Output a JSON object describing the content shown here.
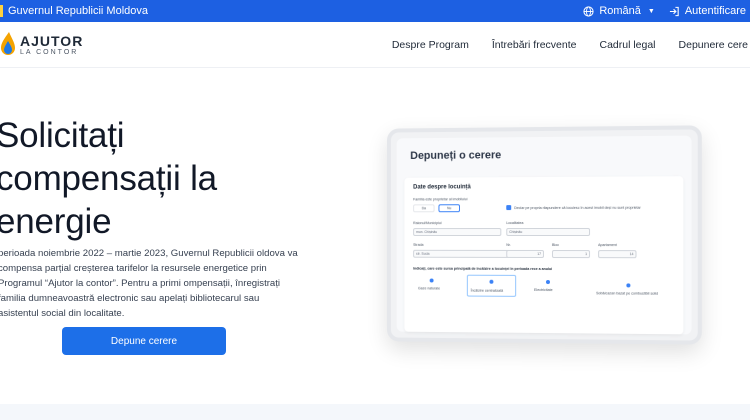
{
  "gov_bar": {
    "title": "Guvernul Republicii Moldova",
    "language": "Română",
    "login": "Autentificare"
  },
  "logo": {
    "title": "AJUTOR",
    "subtitle": "LA CONTOR"
  },
  "nav": {
    "items": [
      "Despre Program",
      "Întrebări frecvente",
      "Cadrul legal",
      "Depunere cere"
    ]
  },
  "hero": {
    "title": "Solicitați compensații la energie",
    "text": "perioada noiembrie 2022 – martie 2023, Guvernul Republicii oldova va compensa parțial creșterea tarifelor la resursele energetice prin Programul “Ajutor la contor”. Pentru a primi ompensații, înregistrați familia dumneavoastră electronic sau apelați bibliotecarul sau asistentul social din localitate.",
    "cta": "Depune cerere"
  },
  "mockup": {
    "title": "Depuneți o cerere",
    "section": "Date despre locuință",
    "owner_q": "Familia este proprietar al imobilului",
    "yes": "Da",
    "no": "Nu",
    "declare": "Declar pe propria răspundere că locuiesc în acest imobil deși nu sunt proprietar",
    "district_label": "Raionul/Municipiul",
    "district_value": "mun. Chișinău",
    "locality_label": "Localitatea",
    "locality_value": "Chișinău",
    "street_label": "Strada",
    "street_value": "str. Sucia",
    "nr_label": "Nr.",
    "nr_value": "17",
    "block_label": "Bloc",
    "block_value": "1",
    "apt_label": "Apartament",
    "apt_value": "14",
    "heating_q": "Indicați, care este sursa principală de încălzire a locuinței în perioada rece a anului",
    "opt_gas": "Gaze naturale",
    "opt_central": "Încălzire centralizată",
    "opt_electric": "Electricitate",
    "opt_solid": "Sobă/cazan bazat pe combustibil solid"
  }
}
